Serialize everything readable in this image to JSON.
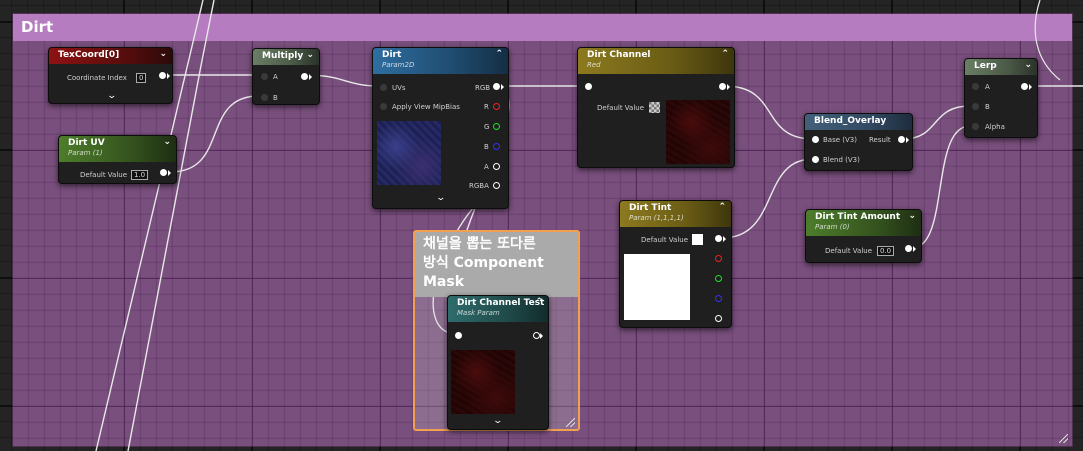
{
  "comment": {
    "title": "Dirt"
  },
  "nodes": {
    "texcoord": {
      "title": "TexCoord[0]",
      "pin_label": "Coordinate Index",
      "value": "0"
    },
    "dirt_uv": {
      "title": "Dirt UV",
      "subtitle": "Param (1)",
      "pin_label": "Default Value",
      "value": "1.0"
    },
    "multiply": {
      "title": "Multiply",
      "in_a": "A",
      "in_b": "B"
    },
    "dirt": {
      "title": "Dirt",
      "subtitle": "Param2D",
      "in_uvs": "UVs",
      "in_mip": "Apply View MipBias",
      "out_rgb": "RGB",
      "out_r": "R",
      "out_g": "G",
      "out_b": "B",
      "out_a": "A",
      "out_rgba": "RGBA"
    },
    "dirt_channel": {
      "title": "Dirt Channel",
      "subtitle": "Red",
      "pin_label": "Default Value"
    },
    "dirt_tint": {
      "title": "Dirt Tint",
      "subtitle": "Param (1,1,1,1)",
      "pin_label": "Default Value"
    },
    "blend_overlay": {
      "title": "Blend_Overlay",
      "in_base": "Base (V3)",
      "in_blend": "Blend (V3)",
      "out_result": "Result"
    },
    "dirt_tint_amount": {
      "title": "Dirt Tint Amount",
      "subtitle": "Param (0)",
      "pin_label": "Default Value",
      "value": "0.0"
    },
    "lerp": {
      "title": "Lerp",
      "in_a": "A",
      "in_b": "B",
      "in_alpha": "Alpha"
    },
    "dirt_channel_test": {
      "title": "Dirt Channel Test",
      "subtitle": "Mask Param"
    }
  },
  "sub_comment": {
    "text": "채널을 뽑는 또다른\n방식 Component\nMask"
  },
  "colors": {
    "comment_fill": "#9a5fa0",
    "comment_header": "#b57cc0",
    "selection_outline": "#f0a050"
  }
}
